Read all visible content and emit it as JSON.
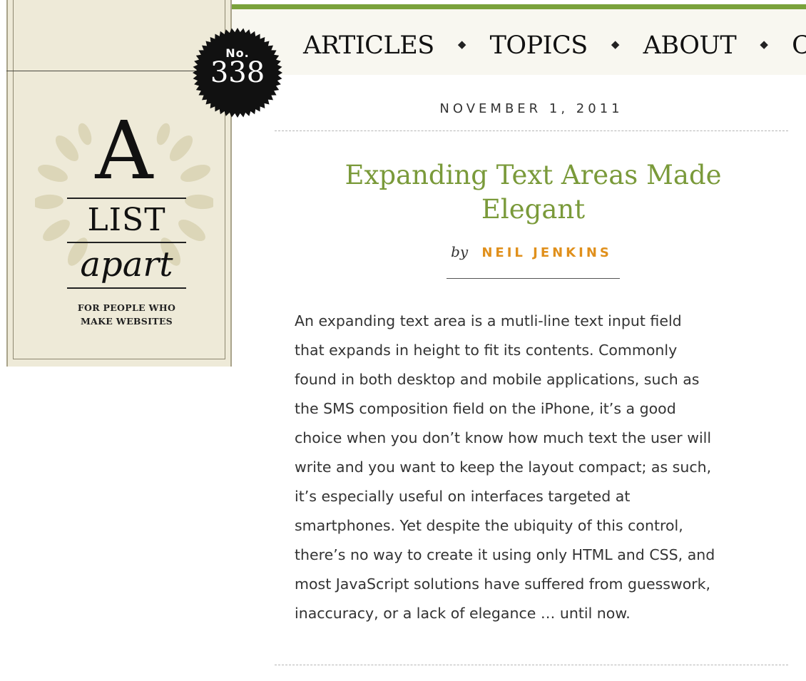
{
  "issue": {
    "prefix": "No.",
    "number": "338"
  },
  "logo": {
    "letter": "A",
    "word1": "LIST",
    "word2": "apart",
    "tagline_line1": "FOR PEOPLE WHO",
    "tagline_line2": "MAKE WEBSITES"
  },
  "nav": {
    "items": [
      "ARTICLES",
      "TOPICS",
      "ABOUT",
      "C"
    ],
    "separator": "◆"
  },
  "article": {
    "date": "NOVEMBER 1, 2011",
    "title_line1": "Expanding Text Areas Made",
    "title_line2": "Elegant",
    "by": "by",
    "author": "NEIL JENKINS",
    "body_lines": [
      "An expanding text area is a mutli-line text input field",
      "that expands in height to fit its contents. Commonly",
      "found in both desktop and mobile applications, such as",
      "the SMS composition field on the iPhone, it’s a good",
      "choice when you don’t know how much text the user will",
      "write and you want to keep the layout compact; as such,",
      "it’s especially useful on interfaces targeted at",
      "smartphones. Yet despite the ubiquity of this control,",
      "there’s no way to create it using only HTML and CSS, and",
      "most JavaScript solutions have suffered from guesswork,",
      "inaccuracy, or a lack of elegance … until now."
    ]
  },
  "colors": {
    "accent_green": "#7aa23c",
    "title_green": "#7a9a3a",
    "author_orange": "#e0901c",
    "logo_background": "#eeead8"
  }
}
